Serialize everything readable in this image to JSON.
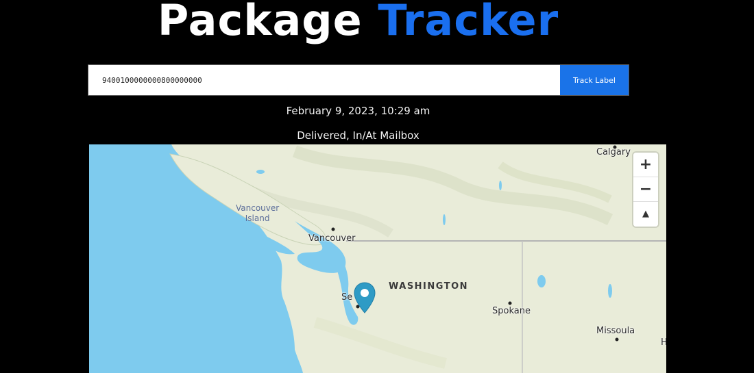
{
  "header": {
    "title_word1": "Package",
    "title_word2": "Tracker"
  },
  "search": {
    "value": "9400100000000800000000",
    "button_label": "Track Label"
  },
  "result": {
    "timestamp": "February 9, 2023, 10:29 am",
    "status": "Delivered, In/At Mailbox"
  },
  "map": {
    "labels": {
      "calgary": "Calgary",
      "vancouver_island_line1": "Vancouver",
      "vancouver_island_line2": "Island",
      "vancouver": "Vancouver",
      "washington": "WASHINGTON",
      "seattle": "Se",
      "spokane": "Spokane",
      "missoula": "Missoula",
      "edge_letter": "H"
    },
    "controls": {
      "zoom_in": "+",
      "zoom_out": "−",
      "reset_north": "▲"
    },
    "marker_icon": "map-pin-icon",
    "colors": {
      "water": "#7ecbee",
      "land": "#e9ecd9",
      "marker": "#2f9bc5",
      "title_accent": "#1a6fef",
      "button": "#1a73e8"
    }
  }
}
